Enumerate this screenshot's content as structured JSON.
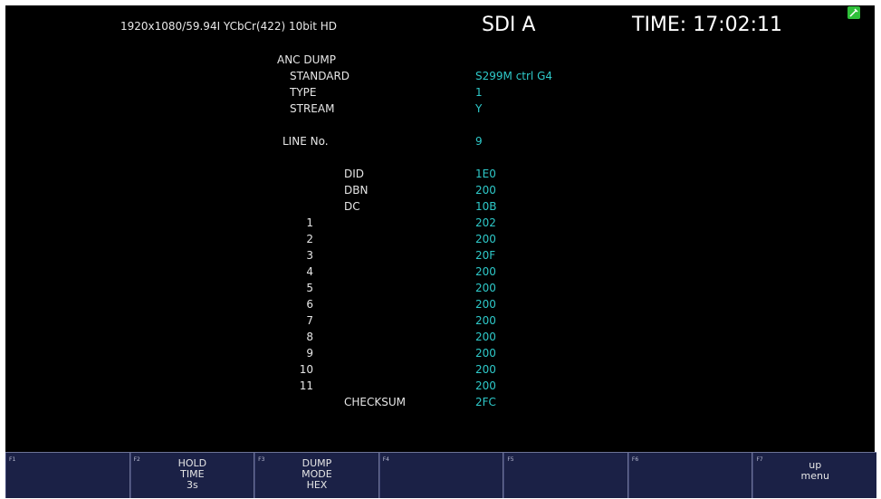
{
  "header": {
    "format": "1920x1080/59.94I YCbCr(422) 10bit HD",
    "input": "SDI A",
    "time": "TIME: 17:02:11"
  },
  "anc": {
    "title": "ANC DUMP",
    "fields": [
      {
        "label": "STANDARD",
        "value": "S299M ctrl G4"
      },
      {
        "label": "TYPE",
        "value": "1"
      },
      {
        "label": "STREAM",
        "value": "Y"
      }
    ],
    "line": {
      "label": "LINE No.",
      "value": "9"
    },
    "header_words": [
      {
        "label": "DID",
        "value": "1E0"
      },
      {
        "label": "DBN",
        "value": "200"
      },
      {
        "label": "DC",
        "value": "10B"
      }
    ],
    "data_words": [
      {
        "index": "1",
        "value": "202"
      },
      {
        "index": "2",
        "value": "200"
      },
      {
        "index": "3",
        "value": "20F"
      },
      {
        "index": "4",
        "value": "200"
      },
      {
        "index": "5",
        "value": "200"
      },
      {
        "index": "6",
        "value": "200"
      },
      {
        "index": "7",
        "value": "200"
      },
      {
        "index": "8",
        "value": "200"
      },
      {
        "index": "9",
        "value": "200"
      },
      {
        "index": "10",
        "value": "200"
      },
      {
        "index": "11",
        "value": "200"
      }
    ],
    "checksum": {
      "label": "CHECKSUM",
      "value": "2FC"
    }
  },
  "fkeys": [
    {
      "num": "F1",
      "lines": []
    },
    {
      "num": "F2",
      "lines": [
        "HOLD",
        "TIME",
        "3s"
      ]
    },
    {
      "num": "F3",
      "lines": [
        "DUMP",
        "MODE",
        "HEX"
      ]
    },
    {
      "num": "F4",
      "lines": []
    },
    {
      "num": "F5",
      "lines": []
    },
    {
      "num": "F6",
      "lines": []
    },
    {
      "num": "F7",
      "lines": [
        "up",
        "menu"
      ]
    }
  ],
  "icons": {
    "usb": "usb-memory-icon"
  },
  "colors": {
    "background": "#000000",
    "label": "#e6e6e6",
    "value": "#2ec9c9",
    "fkey_bar": "#1b2146",
    "usb_icon": "#2fbf3a"
  }
}
